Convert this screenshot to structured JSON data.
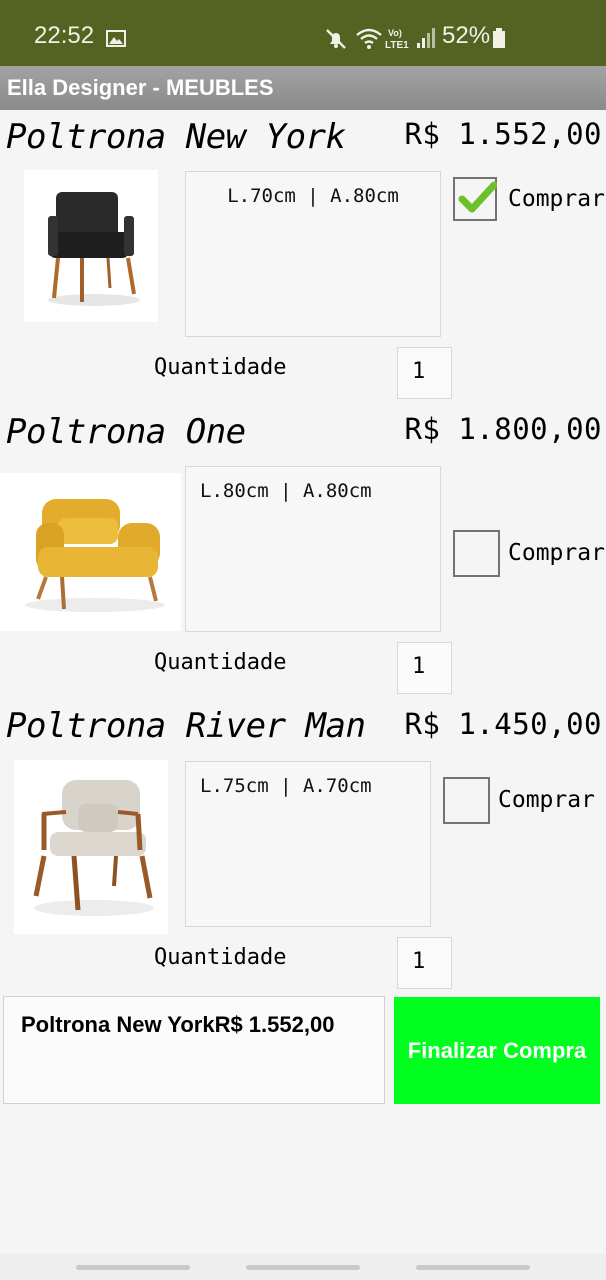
{
  "status_bar": {
    "time": "22:52",
    "battery": "52%",
    "icons": [
      "gallery-icon",
      "mute-icon",
      "wifi-icon",
      "volte-icon",
      "signal-icon",
      "battery-icon"
    ]
  },
  "app": {
    "title": "Ella Designer - MEUBLES"
  },
  "products": [
    {
      "name": "Poltrona New York",
      "price": "R$ 1.552,00",
      "dimensions": "L.70cm | A.80cm",
      "buy_label": "Comprar",
      "checked": true,
      "quantity_label": "Quantidade",
      "quantity": "1",
      "image": "black-armchair"
    },
    {
      "name": "Poltrona One",
      "price": "R$ 1.800,00",
      "dimensions": "L.80cm | A.80cm",
      "buy_label": "Comprar",
      "checked": false,
      "quantity_label": "Quantidade",
      "quantity": "1",
      "image": "yellow-armchair"
    },
    {
      "name": "Poltrona River Man",
      "price": "R$ 1.450,00",
      "dimensions": "L.75cm | A.70cm",
      "buy_label": "Comprar",
      "checked": false,
      "quantity_label": "Quantidade",
      "quantity": "1",
      "image": "wood-beige-armchair"
    }
  ],
  "summary": {
    "text": "Poltrona New YorkR$ 1.552,00"
  },
  "finalize_label": "Finalizar Compra",
  "colors": {
    "status_bar": "#556322",
    "finalize": "#00ff1e",
    "check": "#6cc02a"
  }
}
